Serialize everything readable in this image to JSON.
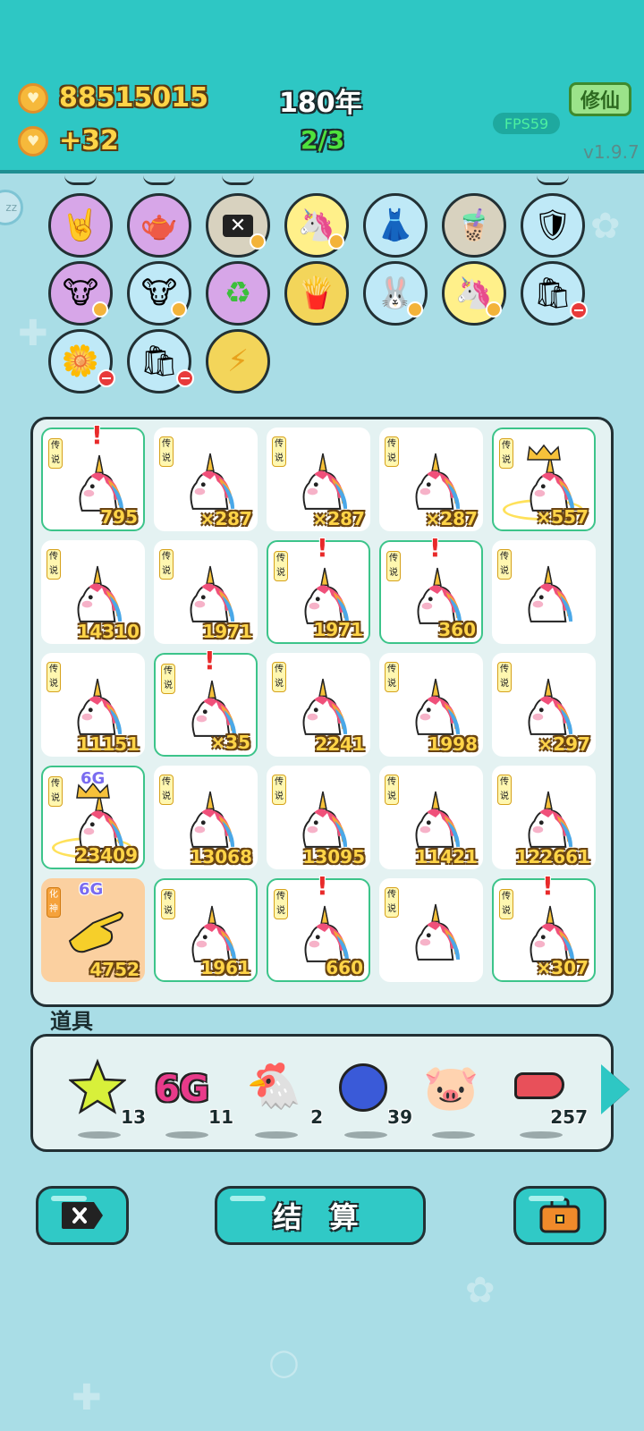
{
  "header": {
    "coins": "88515015",
    "income": "+32",
    "year": "180年",
    "wave": "2/3",
    "mode_button": "修仙",
    "fps": "FPS59",
    "version": "v1.9.7"
  },
  "equipment": [
    {
      "icon": "rock-hand-icon"
    },
    {
      "icon": "gravy-boat-icon"
    },
    {
      "icon": "cancel-ticket-icon"
    },
    {
      "icon": "unicorn-icon"
    },
    {
      "icon": "skirt-icon"
    },
    {
      "icon": "bubble-tea-icon"
    },
    {
      "icon": "shield-wrench-icon"
    },
    {
      "icon": "cow-pair-icon"
    },
    {
      "icon": "cow-pair-icon"
    },
    {
      "icon": "recycle-icon"
    },
    {
      "icon": "fries-icon"
    },
    {
      "icon": "rabbit-icon"
    },
    {
      "icon": "unicorn-icon"
    },
    {
      "icon": "trash-bag-icon"
    },
    {
      "icon": "flower-pot-icon"
    },
    {
      "icon": "trash-bag-icon"
    },
    {
      "icon": "lightning-icon"
    }
  ],
  "board": {
    "tag": "传说",
    "orange_tag": "化神",
    "badge_6g": "6G",
    "cells": [
      {
        "count": "795"
      },
      {
        "count": "×287"
      },
      {
        "count": "×287"
      },
      {
        "count": "×287"
      },
      {
        "count": "×557"
      },
      {
        "count": "14310"
      },
      {
        "count": "1971"
      },
      {
        "count": "1971"
      },
      {
        "count": "360"
      },
      {
        "count": ""
      },
      {
        "count": "11151"
      },
      {
        "count": "×35"
      },
      {
        "count": "2241"
      },
      {
        "count": "1998"
      },
      {
        "count": "×297"
      },
      {
        "count": "23409"
      },
      {
        "count": "13068"
      },
      {
        "count": "13095"
      },
      {
        "count": "11421"
      },
      {
        "count": "122661"
      },
      {
        "count": "4752"
      },
      {
        "count": "1961"
      },
      {
        "count": "660"
      },
      {
        "count": ""
      },
      {
        "count": "×307"
      }
    ]
  },
  "items": {
    "title": "道具",
    "list": [
      {
        "icon": "star-icon",
        "qty": "13"
      },
      {
        "icon": "6g-icon",
        "label": "6G",
        "qty": "11"
      },
      {
        "icon": "chicken-icon",
        "qty": "2"
      },
      {
        "icon": "blueberry-icon",
        "qty": "39"
      },
      {
        "icon": "piggy-bank-icon",
        "qty": ""
      },
      {
        "icon": "liver-icon",
        "qty": "257"
      }
    ]
  },
  "buttons": {
    "settle": "结 算"
  },
  "colors": {
    "header": "#2ec7c4",
    "background": "#a9dde6",
    "coin_text": "#ffd447",
    "wave_text": "#4ee13c",
    "selected_border": "#3cc48a"
  }
}
